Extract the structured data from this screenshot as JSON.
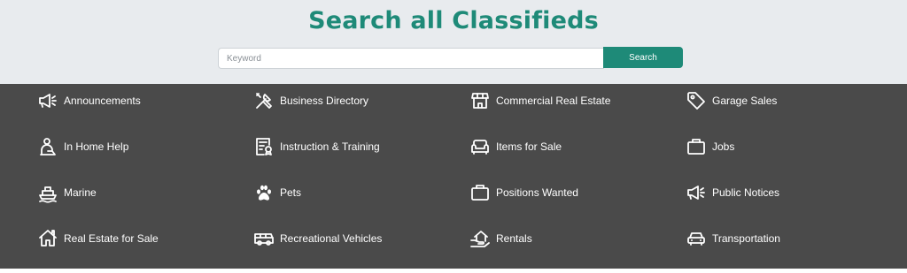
{
  "header": {
    "title": "Search all Classifieds"
  },
  "search": {
    "placeholder": "Keyword",
    "button_label": "Search"
  },
  "categories": [
    {
      "label": "Announcements",
      "icon": "megaphone-icon"
    },
    {
      "label": "Business Directory",
      "icon": "tools-icon"
    },
    {
      "label": "Commercial Real Estate",
      "icon": "storefront-icon"
    },
    {
      "label": "Garage Sales",
      "icon": "tag-icon"
    },
    {
      "label": "In Home Help",
      "icon": "caregiver-icon"
    },
    {
      "label": "Instruction & Training",
      "icon": "certificate-icon"
    },
    {
      "label": "Items for Sale",
      "icon": "couch-icon"
    },
    {
      "label": "Jobs",
      "icon": "briefcase-icon"
    },
    {
      "label": "Marine",
      "icon": "ship-icon"
    },
    {
      "label": "Pets",
      "icon": "paw-icon"
    },
    {
      "label": "Positions Wanted",
      "icon": "briefcase-icon"
    },
    {
      "label": "Public Notices",
      "icon": "megaphone-icon"
    },
    {
      "label": "Real Estate for Sale",
      "icon": "house-icon"
    },
    {
      "label": "Recreational Vehicles",
      "icon": "van-icon"
    },
    {
      "label": "Rentals",
      "icon": "house-hand-icon"
    },
    {
      "label": "Transportation",
      "icon": "car-icon"
    }
  ],
  "colors": {
    "accent": "#1e8a78",
    "panel": "#4a4a4a",
    "header_bg": "#e8ebee"
  }
}
